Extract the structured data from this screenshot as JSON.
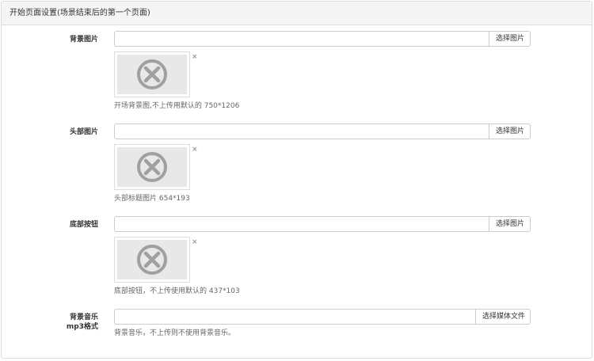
{
  "panel": {
    "title": "开始页面设置(场景结束后的第一个页面)"
  },
  "fields": [
    {
      "label": "背景图片",
      "value": "",
      "button": "选择图片",
      "remove": "×",
      "placeholder_icon": "broken-image-x-icon",
      "help": "开场背景图,不上传用默认的 750*1206"
    },
    {
      "label": "头部图片",
      "value": "",
      "button": "选择图片",
      "remove": "×",
      "placeholder_icon": "broken-image-x-icon",
      "help": "头部标题图片 654*193"
    },
    {
      "label": "底部按钮",
      "value": "",
      "button": "选择图片",
      "remove": "×",
      "placeholder_icon": "broken-image-x-icon",
      "help": "底部按钮，不上传使用默认的 437*103"
    }
  ],
  "music": {
    "label_line1": "背景音乐",
    "label_line2": "mp3格式",
    "value": "",
    "button": "选择媒体文件",
    "help": "背景音乐，不上传则不使用背景音乐。"
  },
  "colors": {
    "border": "#dddddd",
    "heading_bg": "#f5f5f5",
    "placeholder_bg": "#e8e8e8",
    "icon_gray": "#a0a0a0"
  }
}
